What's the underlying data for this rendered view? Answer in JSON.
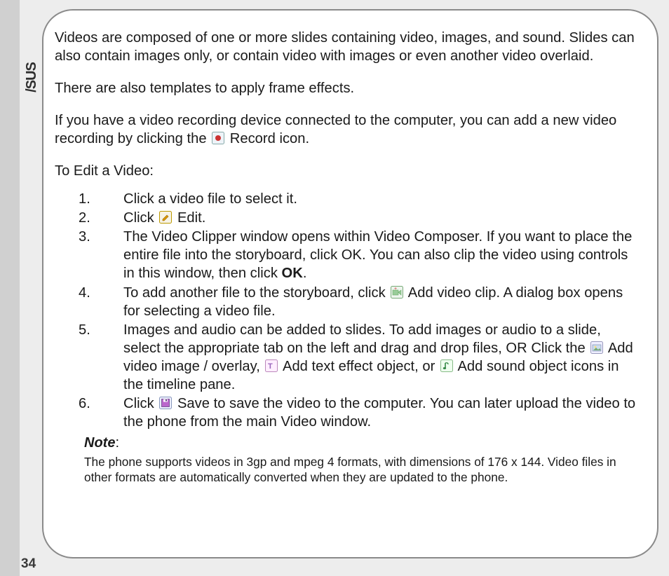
{
  "brand": "/SUS",
  "page_number": "34",
  "paragraphs": {
    "p1": "Videos are composed of one or more slides containing video, images, and sound. Slides can also contain images only, or contain video with images or even another video overlaid.",
    "p2": "There are also templates to apply frame effects.",
    "p3a": "If you have a video recording device connected to the computer, you can add a new video recording by clicking the ",
    "p3b": " Record icon.",
    "p4": "To Edit a Video:"
  },
  "list": {
    "n1": "1.",
    "n2": "2.",
    "n3": "3.",
    "n4": "4.",
    "n5": "5.",
    "n6": "6.",
    "i1": "Click a video file to select it.",
    "i2a": "Click ",
    "i2b": " Edit.",
    "i3a": "The Video Clipper window opens within Video Composer. If you want to place the entire file into the storyboard, click OK. You can also clip the video using controls in this window, then click ",
    "i3b": "OK",
    "i3c": ".",
    "i4a": "To add another file to the storyboard, click ",
    "i4b": " Add video clip. A dialog box opens for selecting a video file.",
    "i5a": "Images and audio can be added to slides. To add images or audio to a slide, select the appropriate tab on the left and drag and drop files, OR Click the ",
    "i5b": " Add video image / overlay, ",
    "i5c": " Add text effect object, or ",
    "i5d": " Add sound object icons in the timeline pane.",
    "i6a": "Click ",
    "i6b": " Save to save the video to the computer. You can later upload the video to the phone from the main Video window."
  },
  "note": {
    "label": "Note",
    "colon": ":",
    "text": "The phone supports videos in 3gp and mpeg 4 formats, with dimensions of 176 x 144. Video files in other formats are automatically converted when they are updated to the phone."
  }
}
